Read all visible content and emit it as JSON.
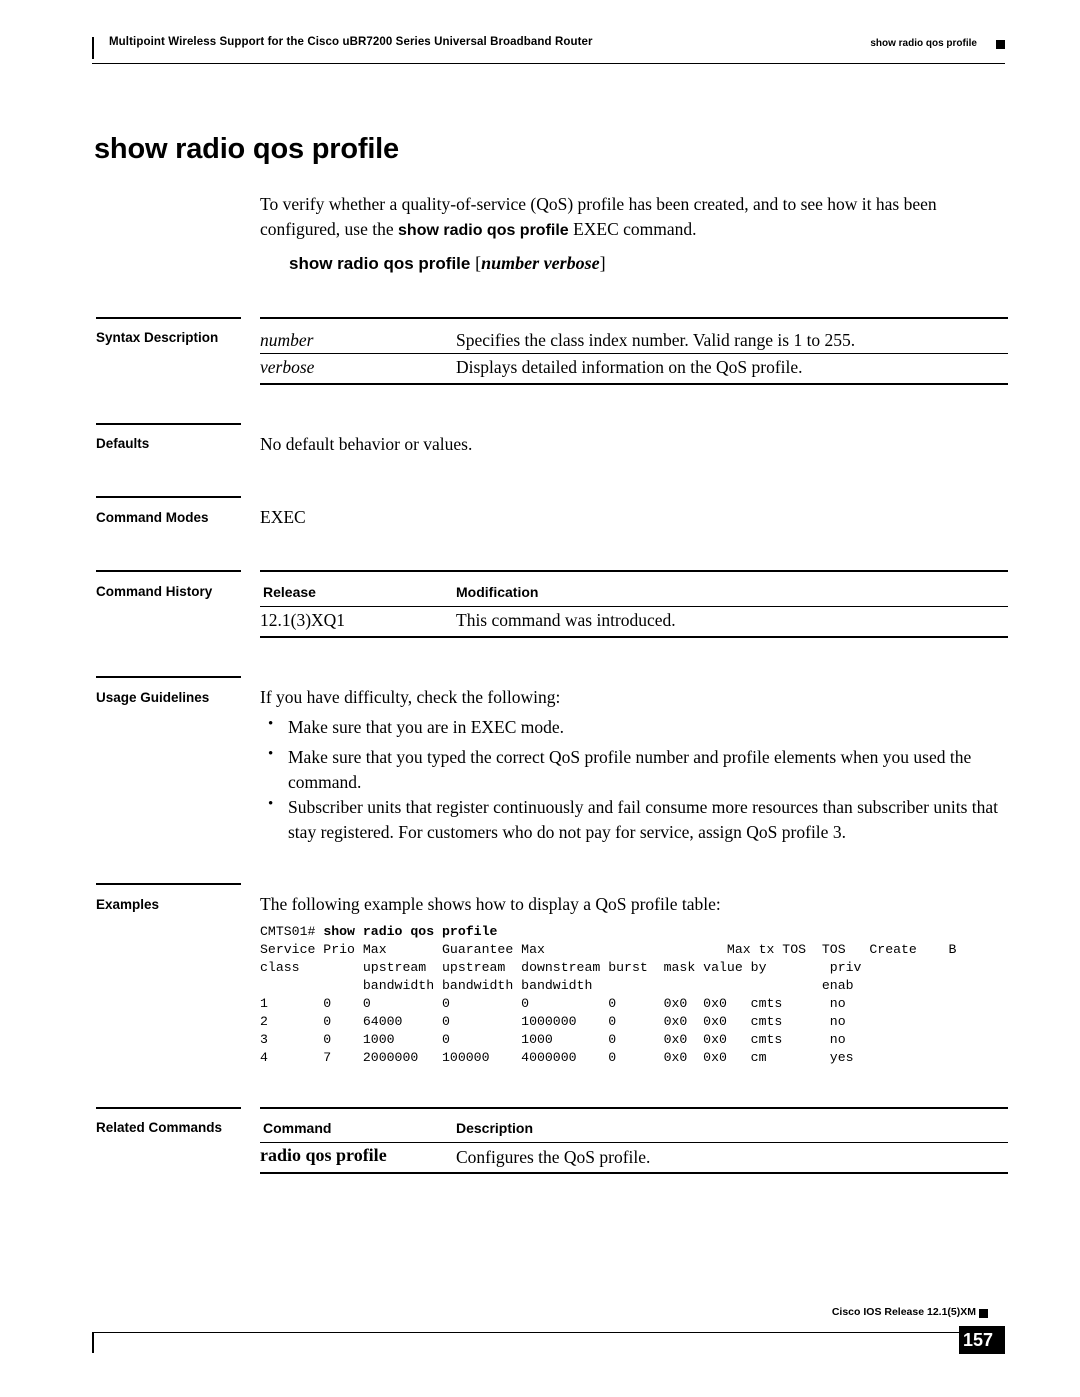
{
  "header": {
    "left_title": "Multipoint Wireless Support for the Cisco uBR7200 Series Universal Broadband Router",
    "right_title": "show radio qos profile"
  },
  "title": "show radio qos profile",
  "intro": {
    "part1": "To verify whether a quality-of-service (QoS) profile has been created, and to see how it has been configured, use the ",
    "bold_cmd": "show radio qos profile",
    "part2": " EXEC command."
  },
  "syntax_line": {
    "command": "show radio qos profile",
    "open_bracket": "[",
    "args": "number verbose",
    "close_bracket": "]"
  },
  "sections": {
    "syntax_description": {
      "label": "Syntax Description",
      "rows": [
        {
          "term": "number",
          "desc": "Specifies the class index number. Valid range is 1 to 255."
        },
        {
          "term": "verbose",
          "desc": "Displays detailed information on the QoS profile."
        }
      ]
    },
    "defaults": {
      "label": "Defaults",
      "text": "No default behavior or values."
    },
    "command_modes": {
      "label": "Command Modes",
      "text": "EXEC"
    },
    "command_history": {
      "label": "Command History",
      "headers": [
        "Release",
        "Modification"
      ],
      "rows": [
        {
          "release": "12.1(3)XQ1",
          "modification": "This command was introduced."
        }
      ]
    },
    "usage_guidelines": {
      "label": "Usage Guidelines",
      "lead": "If you have difficulty, check the following:",
      "bullets": [
        "Make sure that you are in EXEC mode.",
        "Make sure that you typed the correct QoS profile number and profile elements when you used the command.",
        "Subscriber units that register continuously and fail consume more resources than subscriber units that stay registered. For customers who do not pay for service, assign QoS profile 3."
      ]
    },
    "examples": {
      "label": "Examples",
      "lead": "The following example shows how to display a QoS profile table:",
      "code_prompt": "CMTS01# ",
      "code_command": "show radio qos profile",
      "code_lines": [
        "Service Prio Max       Guarantee Max                       Max tx TOS  TOS   Create    B",
        "class        upstream  upstream  downstream burst  mask value by        priv",
        "             bandwidth bandwidth bandwidth                             enab",
        "1       0    0         0         0          0      0x0  0x0   cmts      no",
        "2       0    64000     0         1000000    0      0x0  0x0   cmts      no",
        "3       0    1000      0         1000       0      0x0  0x0   cmts      no",
        "4       7    2000000   100000    4000000    0      0x0  0x0   cm        yes"
      ]
    },
    "related_commands": {
      "label": "Related Commands",
      "headers": [
        "Command",
        "Description"
      ],
      "rows": [
        {
          "command": "radio qos profile",
          "description": "Configures the QoS profile."
        }
      ]
    }
  },
  "footer": {
    "release": "Cisco IOS Release 12.1(5)XM",
    "page_number": "157"
  }
}
